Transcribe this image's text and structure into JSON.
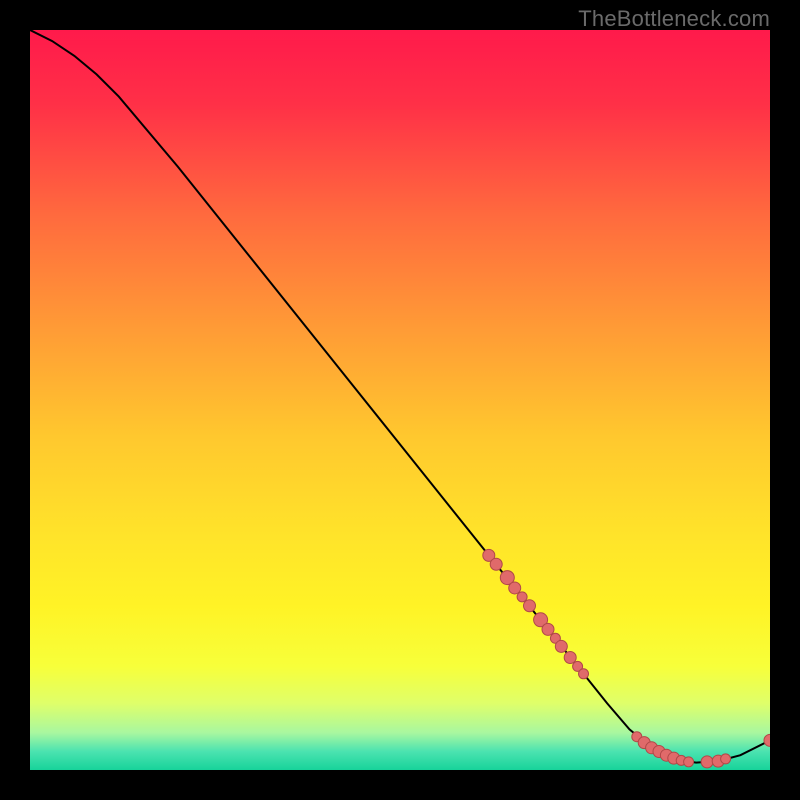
{
  "attribution": "TheBottleneck.com",
  "colors": {
    "background": "#000000",
    "gradient_stops": [
      {
        "offset": 0.0,
        "color": "#ff1a4b"
      },
      {
        "offset": 0.1,
        "color": "#ff3047"
      },
      {
        "offset": 0.25,
        "color": "#ff6a3e"
      },
      {
        "offset": 0.4,
        "color": "#ff9a36"
      },
      {
        "offset": 0.55,
        "color": "#ffc82e"
      },
      {
        "offset": 0.68,
        "color": "#ffe32a"
      },
      {
        "offset": 0.78,
        "color": "#fff326"
      },
      {
        "offset": 0.86,
        "color": "#f7ff3a"
      },
      {
        "offset": 0.91,
        "color": "#dfff6a"
      },
      {
        "offset": 0.95,
        "color": "#a8f7a0"
      },
      {
        "offset": 0.975,
        "color": "#4be3b0"
      },
      {
        "offset": 1.0,
        "color": "#17d39a"
      }
    ],
    "curve": "#000000",
    "point_fill": "#e06a6a",
    "point_stroke": "#b04848"
  },
  "chart_data": {
    "type": "line",
    "title": "",
    "xlabel": "",
    "ylabel": "",
    "xlim": [
      0,
      100
    ],
    "ylim": [
      0,
      100
    ],
    "curve": [
      {
        "x": 0,
        "y": 100
      },
      {
        "x": 3,
        "y": 98.5
      },
      {
        "x": 6,
        "y": 96.5
      },
      {
        "x": 9,
        "y": 94
      },
      {
        "x": 12,
        "y": 91
      },
      {
        "x": 20,
        "y": 81.5
      },
      {
        "x": 30,
        "y": 69
      },
      {
        "x": 40,
        "y": 56.5
      },
      {
        "x": 50,
        "y": 44
      },
      {
        "x": 60,
        "y": 31.5
      },
      {
        "x": 68,
        "y": 21.5
      },
      {
        "x": 74,
        "y": 14
      },
      {
        "x": 78,
        "y": 9
      },
      {
        "x": 81,
        "y": 5.5
      },
      {
        "x": 84,
        "y": 3
      },
      {
        "x": 87,
        "y": 1.5
      },
      {
        "x": 90,
        "y": 1
      },
      {
        "x": 93,
        "y": 1.2
      },
      {
        "x": 96,
        "y": 2
      },
      {
        "x": 100,
        "y": 4
      }
    ],
    "points": [
      {
        "x": 62,
        "y": 29,
        "r": 6
      },
      {
        "x": 63,
        "y": 27.8,
        "r": 6
      },
      {
        "x": 64.5,
        "y": 26,
        "r": 7
      },
      {
        "x": 65.5,
        "y": 24.6,
        "r": 6
      },
      {
        "x": 66.5,
        "y": 23.4,
        "r": 5
      },
      {
        "x": 67.5,
        "y": 22.2,
        "r": 6
      },
      {
        "x": 69,
        "y": 20.3,
        "r": 7
      },
      {
        "x": 70,
        "y": 19,
        "r": 6
      },
      {
        "x": 71,
        "y": 17.8,
        "r": 5
      },
      {
        "x": 71.8,
        "y": 16.7,
        "r": 6
      },
      {
        "x": 73,
        "y": 15.2,
        "r": 6
      },
      {
        "x": 74,
        "y": 14,
        "r": 5
      },
      {
        "x": 74.8,
        "y": 13,
        "r": 5
      },
      {
        "x": 82,
        "y": 4.5,
        "r": 5
      },
      {
        "x": 83,
        "y": 3.7,
        "r": 6
      },
      {
        "x": 84,
        "y": 3,
        "r": 6
      },
      {
        "x": 85,
        "y": 2.5,
        "r": 6
      },
      {
        "x": 86,
        "y": 2,
        "r": 6
      },
      {
        "x": 87,
        "y": 1.6,
        "r": 6
      },
      {
        "x": 88,
        "y": 1.3,
        "r": 5
      },
      {
        "x": 89,
        "y": 1.1,
        "r": 5
      },
      {
        "x": 91.5,
        "y": 1.1,
        "r": 6
      },
      {
        "x": 93,
        "y": 1.2,
        "r": 6
      },
      {
        "x": 94,
        "y": 1.5,
        "r": 5
      },
      {
        "x": 100,
        "y": 4,
        "r": 6
      }
    ]
  }
}
